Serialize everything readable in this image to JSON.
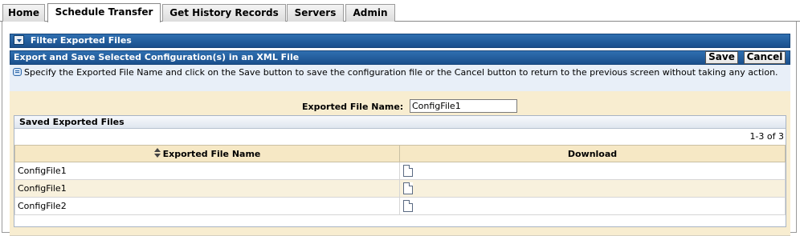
{
  "tabs": [
    {
      "label": "Home"
    },
    {
      "label": "Schedule Transfer"
    },
    {
      "label": "Get History Records"
    },
    {
      "label": "Servers"
    },
    {
      "label": "Admin"
    }
  ],
  "filter": {
    "title": "Filter Exported Files"
  },
  "export": {
    "title": "Export and Save Selected Configuration(s) in an XML File",
    "save_label": "Save",
    "cancel_label": "Cancel",
    "info_text": "Specify the Exported File Name and click on the Save button to save the configuration file or the Cancel button to return to the previous screen without taking any action.",
    "file_name_label": "Exported File Name:",
    "file_name_value": "ConfigFile1"
  },
  "saved": {
    "title": "Saved Exported Files",
    "count": "1-3 of 3",
    "columns": [
      "Exported File Name",
      "Download"
    ],
    "rows": [
      {
        "name": "ConfigFile1",
        "download_icon": "document-icon"
      },
      {
        "name": "ConfigFile1",
        "download_icon": "document-icon"
      },
      {
        "name": "ConfigFile2",
        "download_icon": "document-icon"
      }
    ]
  },
  "colors": {
    "header_blue": "#1a4f8c",
    "form_bg": "#f8edd0",
    "info_bg": "#e8eff8"
  }
}
